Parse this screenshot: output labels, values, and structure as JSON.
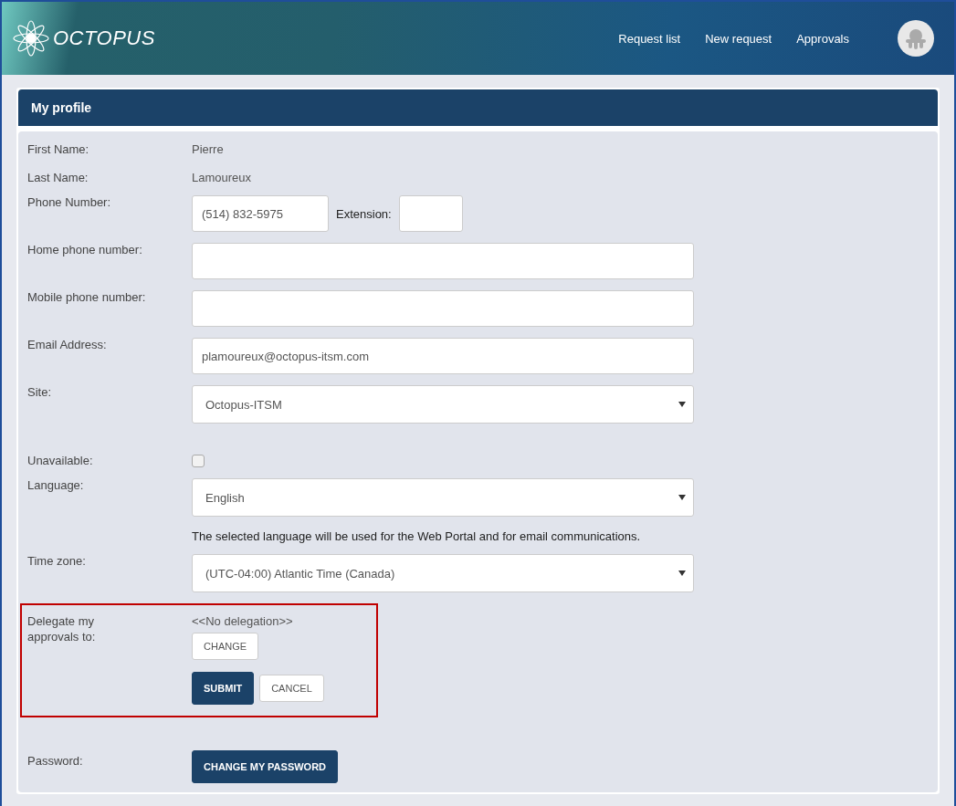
{
  "header": {
    "logo_text": "OCTOPUS",
    "nav": [
      {
        "label": "Request list"
      },
      {
        "label": "New request"
      },
      {
        "label": "Approvals"
      }
    ]
  },
  "panel": {
    "title": "My profile",
    "fields": [
      {
        "kind": "text",
        "label": "First Name:",
        "value": "Pierre"
      },
      {
        "kind": "text",
        "label": "Last Name:",
        "value": "Lamoureux"
      },
      {
        "kind": "phone",
        "label": "Phone Number:",
        "value": "(514) 832-5975",
        "extension_label": "Extension:"
      },
      {
        "kind": "input",
        "label": "Home phone number:"
      },
      {
        "kind": "input",
        "label": "Mobile phone number:"
      },
      {
        "kind": "input",
        "label": "Email Address:",
        "value": "plamoureux@octopus-itsm.com"
      },
      {
        "kind": "select",
        "label": "Site:",
        "value": "Octopus-ITSM"
      },
      {
        "kind": "checkbox",
        "label": "Unavailable:",
        "checked": false
      },
      {
        "kind": "select",
        "label": "Language:",
        "value": "English",
        "hint": "The selected language will be used for the Web Portal and for email communications."
      },
      {
        "kind": "select",
        "label": "Time zone:",
        "value": "(UTC-04:00) Atlantic Time (Canada)"
      },
      {
        "kind": "delegation",
        "label": "Delegate my approvals to:",
        "value": "<<No delegation>>",
        "highlighted": true,
        "change_button": "CHANGE",
        "actions": [
          {
            "label": "SUBMIT",
            "primary": true
          },
          {
            "label": "CANCEL",
            "primary": false
          }
        ]
      },
      {
        "kind": "button",
        "label": "Password:",
        "button": "CHANGE MY PASSWORD"
      }
    ]
  }
}
